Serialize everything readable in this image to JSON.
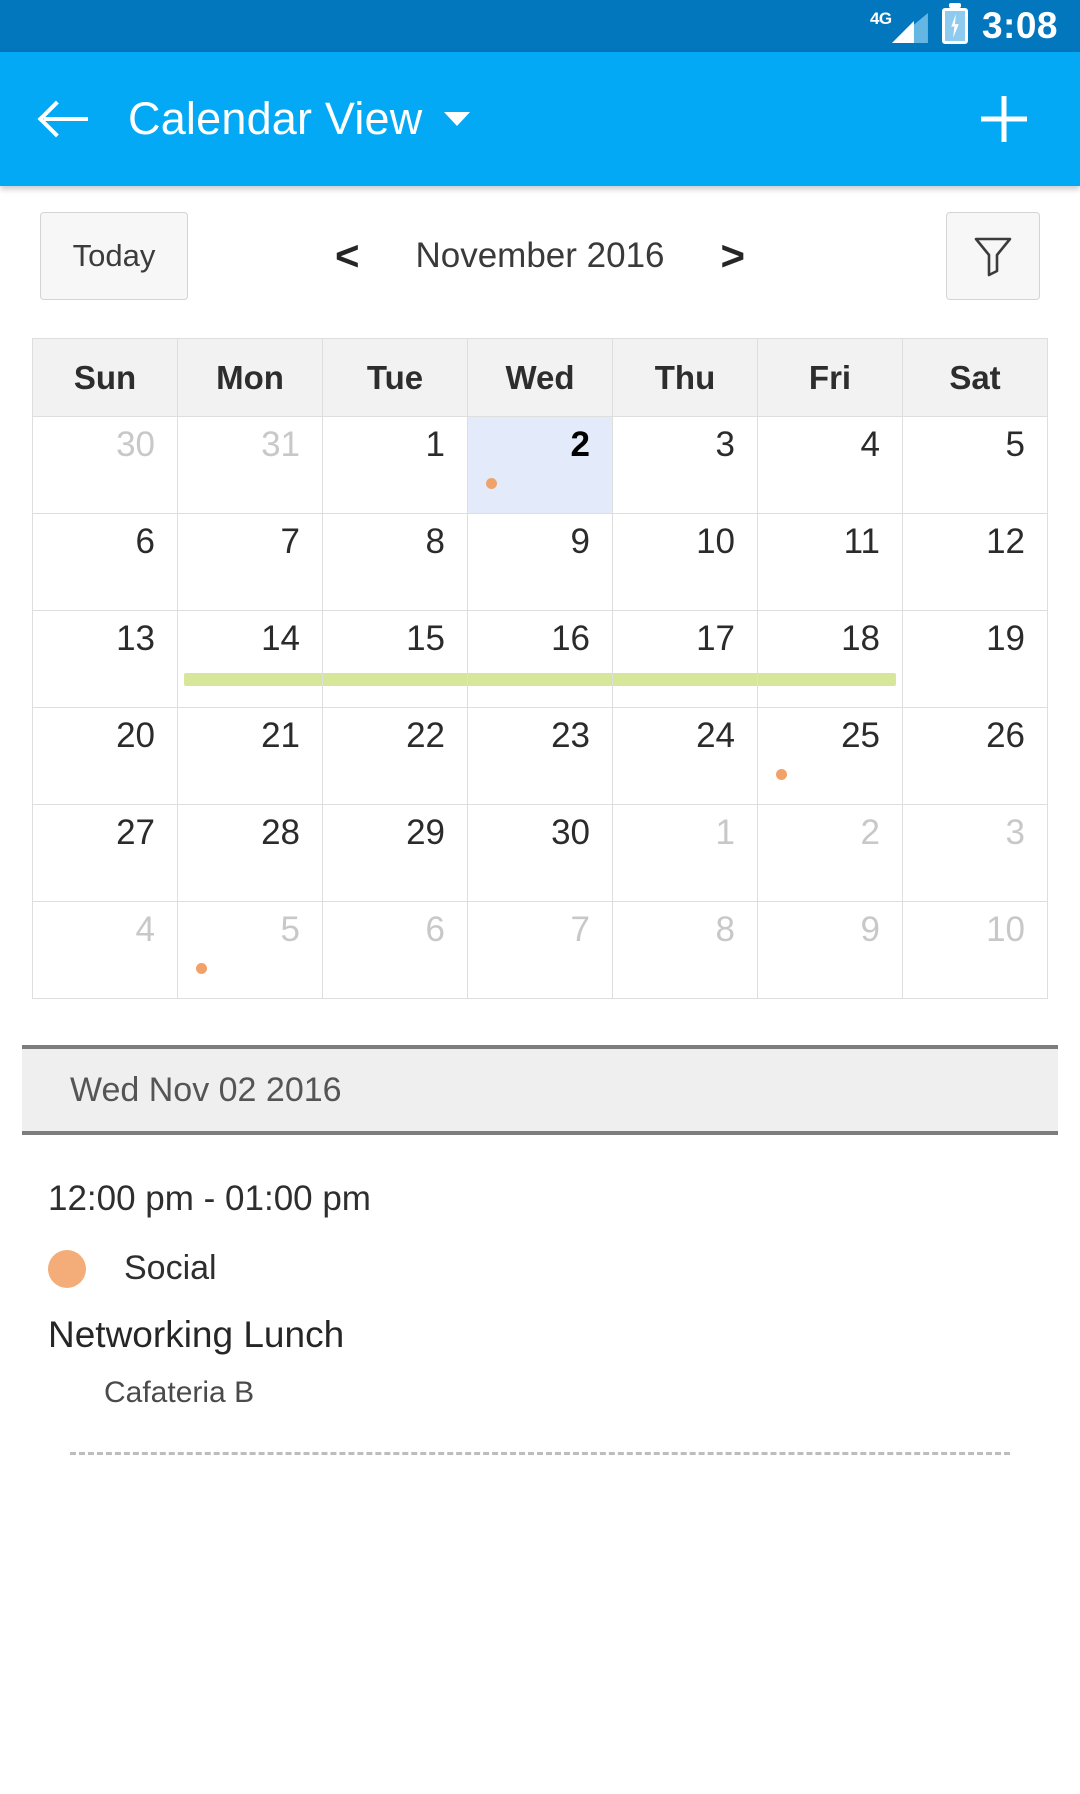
{
  "status_bar": {
    "network_label": "4G",
    "time": "3:08",
    "signal_icon": "signal-bars-icon",
    "battery_icon": "battery-charging-icon"
  },
  "app_bar": {
    "back_icon": "back-arrow-icon",
    "title": "Calendar View",
    "dropdown_icon": "chevron-down-icon",
    "add_icon": "plus-icon"
  },
  "toolbar": {
    "today_label": "Today",
    "prev_label": "<",
    "next_label": ">",
    "month_label": "November 2016",
    "filter_icon": "filter-icon"
  },
  "calendar": {
    "weekday_headers": [
      "Sun",
      "Mon",
      "Tue",
      "Wed",
      "Thu",
      "Fri",
      "Sat"
    ],
    "selected_day": 2,
    "colors": {
      "selected_cell_bg": "#e3ebfb",
      "event_dot": "#f0a26a",
      "event_bar": "#d7e79a",
      "grid_line": "#dedede",
      "header_bg": "#f2f2f2"
    },
    "weeks": [
      [
        {
          "label": "30",
          "month": "other"
        },
        {
          "label": "31",
          "month": "other"
        },
        {
          "label": "1",
          "month": "current"
        },
        {
          "label": "2",
          "month": "current",
          "selected": true,
          "dot": true
        },
        {
          "label": "3",
          "month": "current"
        },
        {
          "label": "4",
          "month": "current"
        },
        {
          "label": "5",
          "month": "current"
        }
      ],
      [
        {
          "label": "6",
          "month": "current"
        },
        {
          "label": "7",
          "month": "current"
        },
        {
          "label": "8",
          "month": "current"
        },
        {
          "label": "9",
          "month": "current"
        },
        {
          "label": "10",
          "month": "current"
        },
        {
          "label": "11",
          "month": "current"
        },
        {
          "label": "12",
          "month": "current"
        }
      ],
      [
        {
          "label": "13",
          "month": "current"
        },
        {
          "label": "14",
          "month": "current",
          "bar": "start"
        },
        {
          "label": "15",
          "month": "current",
          "bar": "mid"
        },
        {
          "label": "16",
          "month": "current",
          "bar": "mid"
        },
        {
          "label": "17",
          "month": "current",
          "bar": "mid"
        },
        {
          "label": "18",
          "month": "current",
          "bar": "end"
        },
        {
          "label": "19",
          "month": "current"
        }
      ],
      [
        {
          "label": "20",
          "month": "current"
        },
        {
          "label": "21",
          "month": "current"
        },
        {
          "label": "22",
          "month": "current"
        },
        {
          "label": "23",
          "month": "current"
        },
        {
          "label": "24",
          "month": "current"
        },
        {
          "label": "25",
          "month": "current",
          "dot": true
        },
        {
          "label": "26",
          "month": "current"
        }
      ],
      [
        {
          "label": "27",
          "month": "current"
        },
        {
          "label": "28",
          "month": "current"
        },
        {
          "label": "29",
          "month": "current"
        },
        {
          "label": "30",
          "month": "current"
        },
        {
          "label": "1",
          "month": "other"
        },
        {
          "label": "2",
          "month": "other"
        },
        {
          "label": "3",
          "month": "other"
        }
      ],
      [
        {
          "label": "4",
          "month": "other"
        },
        {
          "label": "5",
          "month": "other",
          "dot": true
        },
        {
          "label": "6",
          "month": "other"
        },
        {
          "label": "7",
          "month": "other"
        },
        {
          "label": "8",
          "month": "other"
        },
        {
          "label": "9",
          "month": "other"
        },
        {
          "label": "10",
          "month": "other"
        }
      ]
    ]
  },
  "agenda": {
    "date_header": "Wed Nov 02 2016",
    "events": [
      {
        "time": "12:00 pm - 01:00 pm",
        "category": "Social",
        "category_color": "#f4ad79",
        "title": "Networking Lunch",
        "location": "Cafateria B"
      }
    ]
  }
}
